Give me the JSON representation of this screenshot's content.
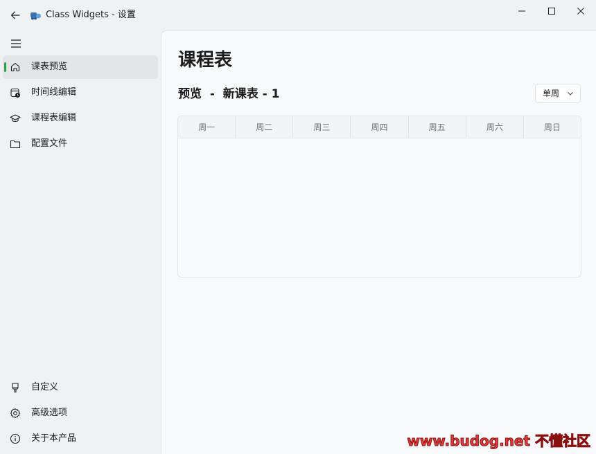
{
  "window": {
    "title": "Class Widgets - 设置"
  },
  "sidebar": {
    "top_items": [
      {
        "label": "课表预览",
        "icon": "home-icon",
        "active": true
      },
      {
        "label": "时间线编辑",
        "icon": "calendar-clock-icon",
        "active": false
      },
      {
        "label": "课程表编辑",
        "icon": "graduation-cap-icon",
        "active": false
      },
      {
        "label": "配置文件",
        "icon": "folder-icon",
        "active": false
      }
    ],
    "bottom_items": [
      {
        "label": "自定义",
        "icon": "brush-icon"
      },
      {
        "label": "高级选项",
        "icon": "gear-icon"
      },
      {
        "label": "关于本产品",
        "icon": "info-icon"
      }
    ]
  },
  "main": {
    "page_title": "课程表",
    "subtitle": "预览  -  新课表 - 1",
    "week_select": {
      "value": "单周"
    },
    "table": {
      "columns": [
        "周一",
        "周二",
        "周三",
        "周四",
        "周五",
        "周六",
        "周日"
      ],
      "rows": []
    }
  },
  "watermark": "www.budog.net 不懂社区",
  "colors": {
    "accent": "#2aa64a",
    "sidebar_bg": "#f0f1f3",
    "content_bg": "#f8f9fb",
    "active_item_bg": "#e4e5e8"
  }
}
